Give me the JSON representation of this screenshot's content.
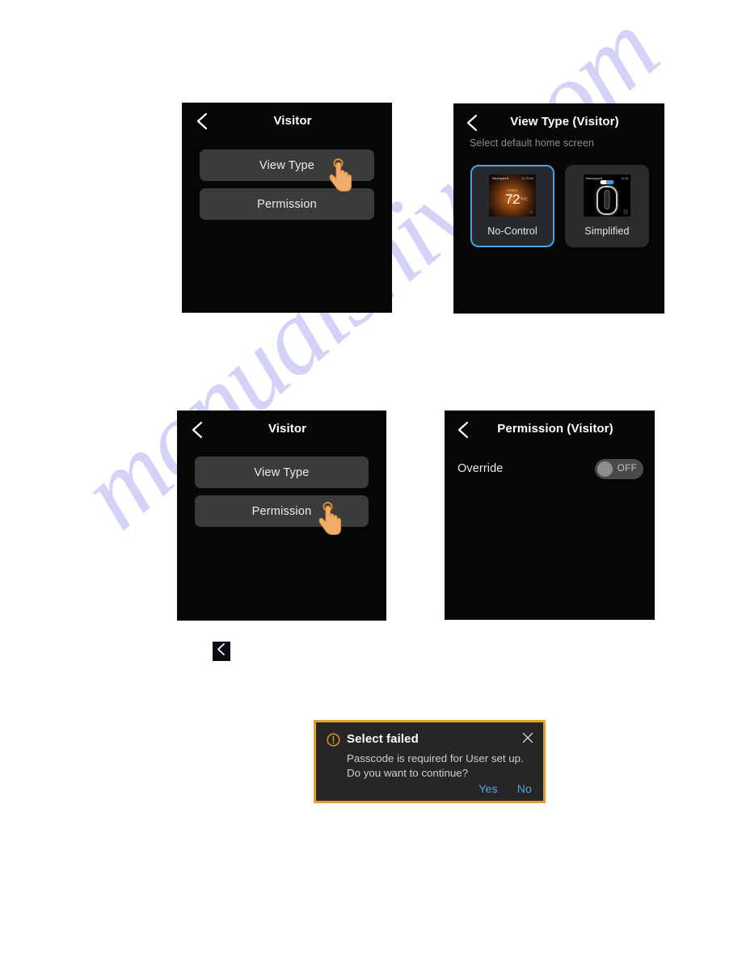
{
  "document": {
    "watermark_text": "manualshive.com",
    "background_color": "#ffffff"
  },
  "colors": {
    "panel_background": "#060606",
    "menu_button": "#3b3b3b",
    "selection_blue": "#46a2e0",
    "hand_cursor_orange": "#f0a868",
    "dialog_border_gold": "#e0a030",
    "dialog_link_blue": "#58a6dd",
    "toggle_track": "#4a4a4a",
    "toggle_knob": "#8e8e8e"
  },
  "panels": {
    "visitor_view_type": {
      "back_icon": "chevron-left-icon",
      "title": "Visitor",
      "buttons": [
        {
          "label": "View Type"
        },
        {
          "label": "Permission"
        }
      ],
      "tapped_button": "View Type",
      "cursor_icon": "tap-hand-icon"
    },
    "view_type_visitor": {
      "back_icon": "chevron-left-icon",
      "title": "View Type (Visitor)",
      "subtitle": "Select default home screen",
      "cards": [
        {
          "label": "No-Control",
          "selected": true,
          "thumbnail": {
            "brand": "Honeywell",
            "status": "10:18 AM",
            "sub": "Cool to",
            "temperature": "72",
            "unit": "°F/C",
            "corner_icon": "fan-icon"
          }
        },
        {
          "label": "Simplified",
          "selected": false,
          "thumbnail": {
            "brand": "Honeywell",
            "status": "10:18",
            "corner_icon": "menu-icon"
          }
        }
      ]
    },
    "visitor_permission": {
      "back_icon": "chevron-left-icon",
      "title": "Visitor",
      "buttons": [
        {
          "label": "View Type"
        },
        {
          "label": "Permission"
        }
      ],
      "tapped_button": "Permission",
      "cursor_icon": "tap-hand-icon"
    },
    "permission_visitor": {
      "back_icon": "chevron-left-icon",
      "title": "Permission (Visitor)",
      "rows": [
        {
          "label": "Override",
          "toggle_state": "OFF"
        }
      ]
    }
  },
  "standalone_back_button": {
    "icon": "chevron-left-icon"
  },
  "dialog": {
    "warning_icon": "exclamation-circle-icon",
    "title": "Select failed",
    "close_icon": "close-icon",
    "message_line1": "Passcode is required for User set up.",
    "message_line2": "Do you want to continue?",
    "actions": [
      {
        "label": "Yes"
      },
      {
        "label": "No"
      }
    ]
  }
}
